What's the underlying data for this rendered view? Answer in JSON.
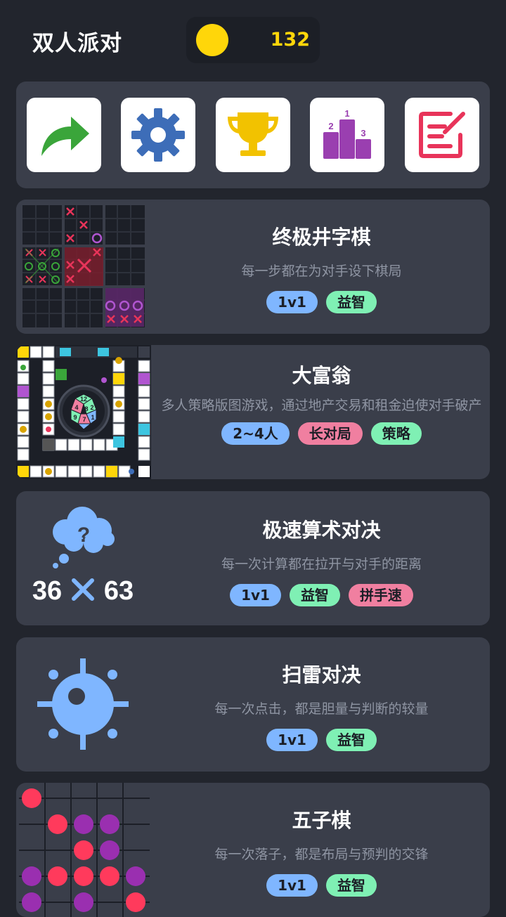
{
  "header": {
    "title": "双人派对",
    "coins": "132"
  },
  "toolbar": {
    "buttons": [
      {
        "name": "share-button",
        "icon": "share-arrow-icon"
      },
      {
        "name": "settings-button",
        "icon": "gear-icon"
      },
      {
        "name": "trophy-button",
        "icon": "trophy-icon"
      },
      {
        "name": "leaderboard-button",
        "icon": "podium-icon",
        "podium_labels": [
          "1",
          "2",
          "3"
        ]
      },
      {
        "name": "notes-button",
        "icon": "edit-note-icon"
      }
    ]
  },
  "games": [
    {
      "title": "终极井字棋",
      "desc": "每一步都在为对手设下棋局",
      "tags": [
        "1v1",
        "益智"
      ]
    },
    {
      "title": "大富翁",
      "desc": "多人策略版图游戏，通过地产交易和租金迫使对手破产",
      "tags": [
        "2~4人",
        "长对局",
        "策略"
      ],
      "dice_numbers": [
        "12",
        "4",
        "8",
        "2",
        "9",
        "7",
        "1"
      ]
    },
    {
      "title": "极速算术对决",
      "desc": "每一次计算都在拉开与对手的距离",
      "tags": [
        "1v1",
        "益智",
        "拼手速"
      ],
      "thumb_question": "?",
      "thumb_left": "36",
      "thumb_right": "63"
    },
    {
      "title": "扫雷对决",
      "desc": "每一次点击，都是胆量与判断的较量",
      "tags": [
        "1v1",
        "益智"
      ]
    },
    {
      "title": "五子棋",
      "desc": "每一次落子，都是布局与预判的交锋",
      "tags": [
        "1v1",
        "益智"
      ]
    }
  ],
  "colors": {
    "background": "#22252d",
    "card": "#3a3e4a",
    "coin": "#ffd60a",
    "tag_blue": "#7fb6ff",
    "tag_green": "#7ff0b4",
    "tag_pink": "#f07fa0"
  }
}
